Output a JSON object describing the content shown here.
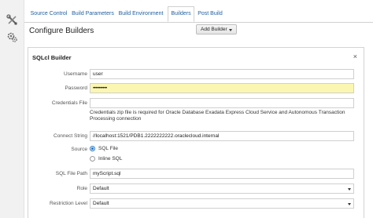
{
  "tabs": [
    {
      "label": "Source Control",
      "active": false
    },
    {
      "label": "Build Parameters",
      "active": false
    },
    {
      "label": "Build Environment",
      "active": false
    },
    {
      "label": "Builders",
      "active": true
    },
    {
      "label": "Post Build",
      "active": false
    }
  ],
  "page_title": "Configure Builders",
  "add_builder_label": "Add Builder",
  "panel": {
    "title": "SQLcl Builder",
    "close": "×",
    "fields": {
      "username": {
        "label": "Username",
        "value": "user"
      },
      "password": {
        "label": "Password",
        "value": "••••••••••"
      },
      "credentials": {
        "label": "Credentials File",
        "value": "",
        "help": "Credentials zip file is required for Oracle Database Exadata Express Cloud Service and Autonomous Transaction Processing connection"
      },
      "connect": {
        "label": "Connect String",
        "value": "//localhost:1521/PDB1.2222222222.oraclecloud.internal"
      },
      "source": {
        "label": "Source",
        "options": [
          "SQL File",
          "Inline SQL"
        ],
        "selected": "SQL File"
      },
      "sql_file_path": {
        "label": "SQL File Path",
        "value": "myScript.sql"
      },
      "role": {
        "label": "Role",
        "value": "Default"
      },
      "restriction": {
        "label": "Restriction Level",
        "value": "Default"
      }
    }
  },
  "icons": {
    "rail_top": "wrench-screwdriver-icon",
    "rail_bottom": "gears-icon"
  },
  "colors": {
    "accent": "#1f5f9f",
    "password_bg": "#fbf7b2",
    "radio": "#2a78c6"
  }
}
